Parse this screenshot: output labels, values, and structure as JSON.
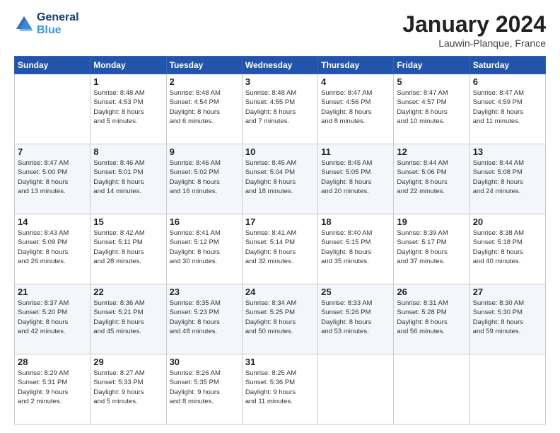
{
  "header": {
    "logo_line1": "General",
    "logo_line2": "Blue",
    "month": "January 2024",
    "location": "Lauwin-Planque, France"
  },
  "weekdays": [
    "Sunday",
    "Monday",
    "Tuesday",
    "Wednesday",
    "Thursday",
    "Friday",
    "Saturday"
  ],
  "weeks": [
    [
      {
        "day": "",
        "info": ""
      },
      {
        "day": "1",
        "info": "Sunrise: 8:48 AM\nSunset: 4:53 PM\nDaylight: 8 hours\nand 5 minutes."
      },
      {
        "day": "2",
        "info": "Sunrise: 8:48 AM\nSunset: 4:54 PM\nDaylight: 8 hours\nand 6 minutes."
      },
      {
        "day": "3",
        "info": "Sunrise: 8:48 AM\nSunset: 4:55 PM\nDaylight: 8 hours\nand 7 minutes."
      },
      {
        "day": "4",
        "info": "Sunrise: 8:47 AM\nSunset: 4:56 PM\nDaylight: 8 hours\nand 8 minutes."
      },
      {
        "day": "5",
        "info": "Sunrise: 8:47 AM\nSunset: 4:57 PM\nDaylight: 8 hours\nand 10 minutes."
      },
      {
        "day": "6",
        "info": "Sunrise: 8:47 AM\nSunset: 4:59 PM\nDaylight: 8 hours\nand 11 minutes."
      }
    ],
    [
      {
        "day": "7",
        "info": "Sunrise: 8:47 AM\nSunset: 5:00 PM\nDaylight: 8 hours\nand 13 minutes."
      },
      {
        "day": "8",
        "info": "Sunrise: 8:46 AM\nSunset: 5:01 PM\nDaylight: 8 hours\nand 14 minutes."
      },
      {
        "day": "9",
        "info": "Sunrise: 8:46 AM\nSunset: 5:02 PM\nDaylight: 8 hours\nand 16 minutes."
      },
      {
        "day": "10",
        "info": "Sunrise: 8:45 AM\nSunset: 5:04 PM\nDaylight: 8 hours\nand 18 minutes."
      },
      {
        "day": "11",
        "info": "Sunrise: 8:45 AM\nSunset: 5:05 PM\nDaylight: 8 hours\nand 20 minutes."
      },
      {
        "day": "12",
        "info": "Sunrise: 8:44 AM\nSunset: 5:06 PM\nDaylight: 8 hours\nand 22 minutes."
      },
      {
        "day": "13",
        "info": "Sunrise: 8:44 AM\nSunset: 5:08 PM\nDaylight: 8 hours\nand 24 minutes."
      }
    ],
    [
      {
        "day": "14",
        "info": "Sunrise: 8:43 AM\nSunset: 5:09 PM\nDaylight: 8 hours\nand 26 minutes."
      },
      {
        "day": "15",
        "info": "Sunrise: 8:42 AM\nSunset: 5:11 PM\nDaylight: 8 hours\nand 28 minutes."
      },
      {
        "day": "16",
        "info": "Sunrise: 8:41 AM\nSunset: 5:12 PM\nDaylight: 8 hours\nand 30 minutes."
      },
      {
        "day": "17",
        "info": "Sunrise: 8:41 AM\nSunset: 5:14 PM\nDaylight: 8 hours\nand 32 minutes."
      },
      {
        "day": "18",
        "info": "Sunrise: 8:40 AM\nSunset: 5:15 PM\nDaylight: 8 hours\nand 35 minutes."
      },
      {
        "day": "19",
        "info": "Sunrise: 8:39 AM\nSunset: 5:17 PM\nDaylight: 8 hours\nand 37 minutes."
      },
      {
        "day": "20",
        "info": "Sunrise: 8:38 AM\nSunset: 5:18 PM\nDaylight: 8 hours\nand 40 minutes."
      }
    ],
    [
      {
        "day": "21",
        "info": "Sunrise: 8:37 AM\nSunset: 5:20 PM\nDaylight: 8 hours\nand 42 minutes."
      },
      {
        "day": "22",
        "info": "Sunrise: 8:36 AM\nSunset: 5:21 PM\nDaylight: 8 hours\nand 45 minutes."
      },
      {
        "day": "23",
        "info": "Sunrise: 8:35 AM\nSunset: 5:23 PM\nDaylight: 8 hours\nand 48 minutes."
      },
      {
        "day": "24",
        "info": "Sunrise: 8:34 AM\nSunset: 5:25 PM\nDaylight: 8 hours\nand 50 minutes."
      },
      {
        "day": "25",
        "info": "Sunrise: 8:33 AM\nSunset: 5:26 PM\nDaylight: 8 hours\nand 53 minutes."
      },
      {
        "day": "26",
        "info": "Sunrise: 8:31 AM\nSunset: 5:28 PM\nDaylight: 8 hours\nand 56 minutes."
      },
      {
        "day": "27",
        "info": "Sunrise: 8:30 AM\nSunset: 5:30 PM\nDaylight: 8 hours\nand 59 minutes."
      }
    ],
    [
      {
        "day": "28",
        "info": "Sunrise: 8:29 AM\nSunset: 5:31 PM\nDaylight: 9 hours\nand 2 minutes."
      },
      {
        "day": "29",
        "info": "Sunrise: 8:27 AM\nSunset: 5:33 PM\nDaylight: 9 hours\nand 5 minutes."
      },
      {
        "day": "30",
        "info": "Sunrise: 8:26 AM\nSunset: 5:35 PM\nDaylight: 9 hours\nand 8 minutes."
      },
      {
        "day": "31",
        "info": "Sunrise: 8:25 AM\nSunset: 5:36 PM\nDaylight: 9 hours\nand 11 minutes."
      },
      {
        "day": "",
        "info": ""
      },
      {
        "day": "",
        "info": ""
      },
      {
        "day": "",
        "info": ""
      }
    ]
  ]
}
